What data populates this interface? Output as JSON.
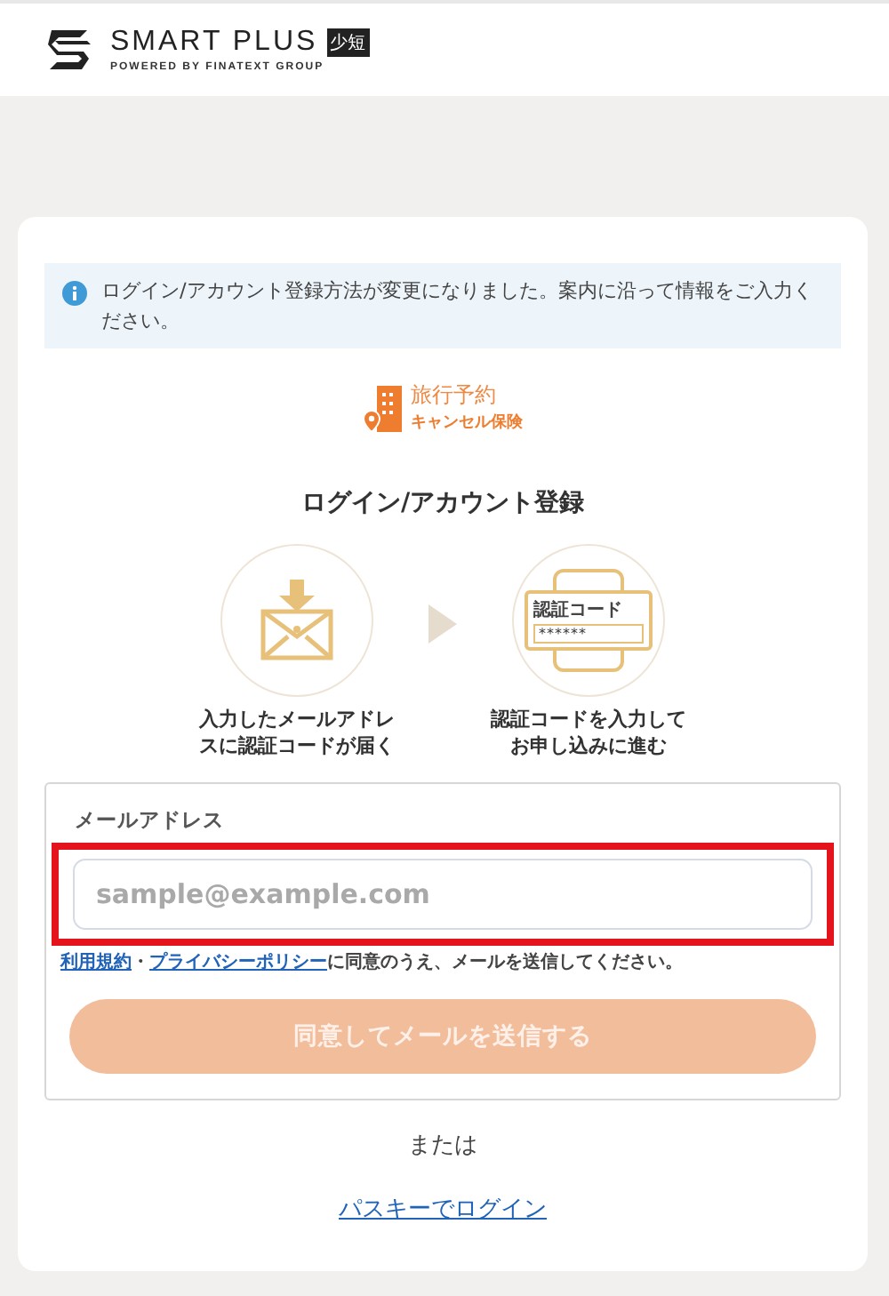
{
  "header": {
    "brand": "SMART PLUS",
    "badge": "少短",
    "tagline": "POWERED BY FINATEXT GROUP"
  },
  "notice": {
    "text": "ログイン/アカウント登録方法が変更になりました。案内に沿って情報をご入力ください。"
  },
  "product": {
    "line_1": "旅行予約",
    "line_2": "キャンセル保険"
  },
  "title": "ログイン/アカウント登録",
  "steps": [
    {
      "kind": "mail",
      "caption": "入力したメールアドレスに認証コードが届く"
    },
    {
      "kind": "code",
      "caption": "認証コードを入力してお申し込みに進む",
      "code_label": "認証コード",
      "code_value": "******"
    }
  ],
  "form": {
    "label": "メールアドレス",
    "placeholder": "sample@example.com",
    "highlighted": true,
    "terms": {
      "links": [
        "利用規約",
        "プライバシーポリシー"
      ],
      "separator": "・",
      "text": "に同意のうえ、メールを送信してください。"
    },
    "submit": {
      "label": "同意してメールを送信する",
      "disabled": true
    }
  },
  "or_text": "または",
  "passkey_link": "パスキーでログイン"
}
